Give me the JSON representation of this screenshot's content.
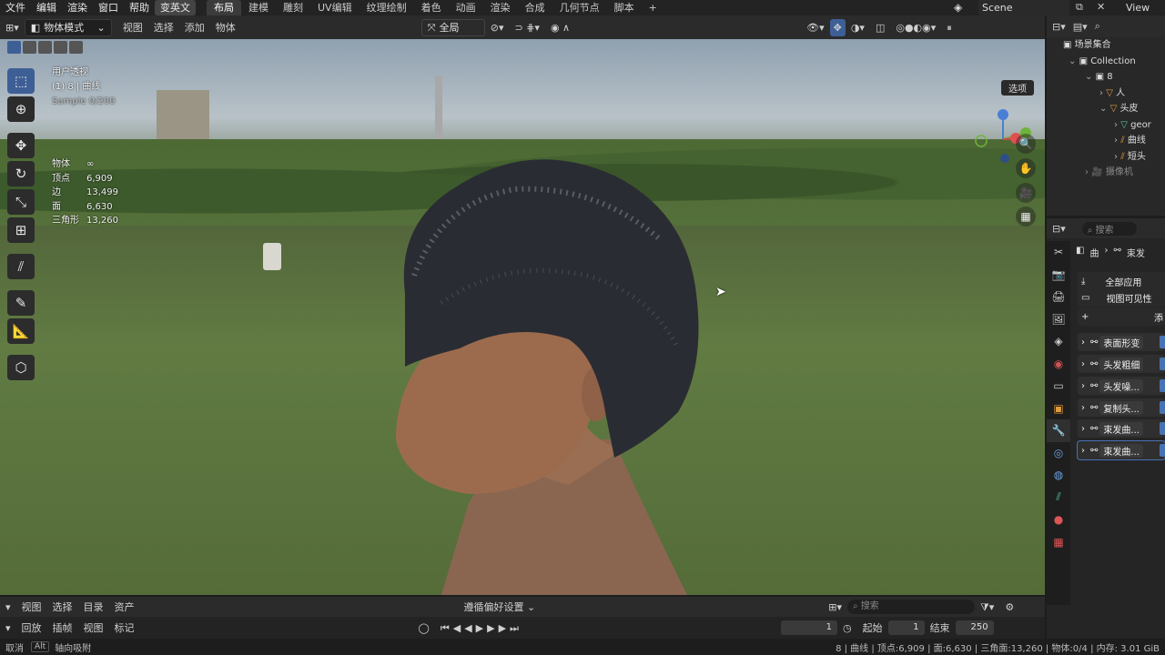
{
  "app": {
    "scene": "Scene",
    "view_label": "View"
  },
  "menu": [
    "文件",
    "编辑",
    "渲染",
    "窗口",
    "帮助"
  ],
  "menu_active": "变英文",
  "workspaces": [
    "布局",
    "建模",
    "雕刻",
    "UV编辑",
    "纹理绘制",
    "着色",
    "动画",
    "渲染",
    "合成",
    "几何节点",
    "脚本"
  ],
  "workspace_active": "布局",
  "viewport_header": {
    "mode": "物体模式",
    "menus": [
      "视图",
      "选择",
      "添加",
      "物体"
    ],
    "orientation": "全局",
    "options": "选项"
  },
  "viewport": {
    "view_name": "用户透视",
    "object_info": "(1) 8 | 曲线",
    "sample": "Sample 0/200",
    "stats": [
      {
        "k": "物体",
        "v": "∞"
      },
      {
        "k": "顶点",
        "v": "6,909"
      },
      {
        "k": "边",
        "v": "13,499"
      },
      {
        "k": "面",
        "v": "6,630"
      },
      {
        "k": "三角形",
        "v": "13,260"
      }
    ]
  },
  "outliner": {
    "title": "场景集合",
    "items": [
      {
        "label": "Collection",
        "depth": 1
      },
      {
        "label": "8",
        "depth": 2
      },
      {
        "label": "人",
        "depth": 3
      },
      {
        "label": "头皮",
        "depth": 3
      },
      {
        "label": "geor",
        "depth": 4
      },
      {
        "label": "曲线",
        "depth": 4
      },
      {
        "label": "短头",
        "depth": 4
      },
      {
        "label": "摄像机",
        "depth": 2
      }
    ]
  },
  "properties": {
    "search_placeholder": "搜索",
    "object_name": "曲",
    "modifier_name": "束发",
    "apply_all": "全部应用",
    "viewport_visibility": "视图可见性",
    "add": "添",
    "modifiers": [
      "表面形变",
      "头发粗细",
      "头发噪...",
      "复制头...",
      "束发曲...",
      "束发曲..."
    ]
  },
  "bottom_header": {
    "menus": [
      "视图",
      "选择",
      "目录",
      "资产"
    ],
    "title": "遵循偏好设置",
    "search_placeholder": "搜索"
  },
  "timeline": {
    "menus": [
      "回放",
      "插帧",
      "视图",
      "标记"
    ],
    "current_frame": "1",
    "start_label": "起始",
    "start": "1",
    "end_label": "结束",
    "end": "250"
  },
  "statusbar": {
    "left": "取消",
    "key": "Alt",
    "hint": "轴向吸附",
    "right": "8 | 曲线 | 顶点:6,909 | 面:6,630 | 三角面:13,260 | 物体:0/4 | 内存: 3.01 GiB"
  }
}
